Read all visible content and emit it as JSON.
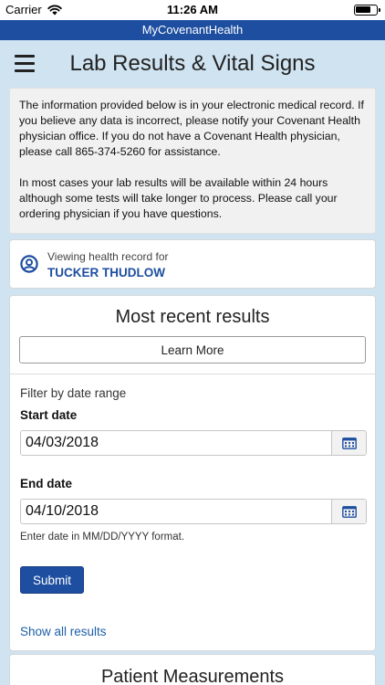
{
  "status_bar": {
    "carrier": "Carrier",
    "time": "11:26 AM"
  },
  "brand": {
    "name": "MyCovenantHealth",
    "color": "#1d4ea0"
  },
  "header": {
    "title": "Lab Results & Vital Signs",
    "menu_icon": "hamburger-menu-icon"
  },
  "info": {
    "paragraph1": "The information provided below is in your electronic medical record. If you believe any data is incorrect, please notify your Covenant Health physician office.  If you do not have a Covenant Health physician, please call 865-374-5260 for assistance.",
    "paragraph2": "In most cases your lab results will be available within 24 hours although some tests will take longer to process.  Please call your ordering physician if you have questions."
  },
  "viewing": {
    "label": "Viewing health record for",
    "name": "TUCKER THUDLOW",
    "icon": "person-circle-icon"
  },
  "results": {
    "title": "Most recent results",
    "learn_more_label": "Learn More",
    "filter_label": "Filter by date range",
    "start_label": "Start date",
    "start_value": "04/03/2018",
    "end_label": "End date",
    "end_value": "04/10/2018",
    "format_hint": "Enter date in MM/DD/YYYY format.",
    "submit_label": "Submit",
    "show_all_label": "Show all results",
    "calendar_icon": "calendar-icon"
  },
  "measurements": {
    "title": "Patient Measurements"
  }
}
